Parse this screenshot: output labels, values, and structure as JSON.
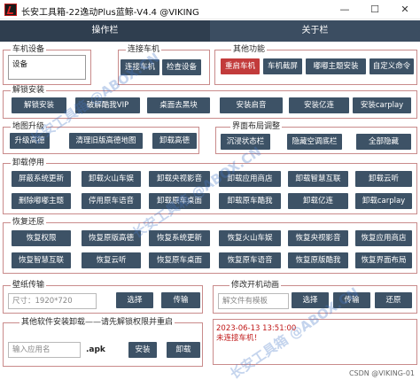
{
  "window": {
    "title": "长安工具箱-22逸动Plus蓝鲸-V4.4 @VIKING",
    "minimize": "—",
    "maximize": "☐",
    "close": "✕"
  },
  "tabs": [
    {
      "label": "操作栏",
      "active": true
    },
    {
      "label": "关于栏",
      "active": false
    }
  ],
  "device_section": {
    "label": "车机设备",
    "device_value": "设备"
  },
  "connect_section": {
    "label": "连接车机",
    "buttons": [
      "连接车机",
      "检查设备"
    ]
  },
  "other_section": {
    "label": "其他功能",
    "buttons": [
      "重启车机",
      "车机截屏",
      "嘟嘟主题安装",
      "自定义命令"
    ]
  },
  "crack_section": {
    "label": "解锁安装",
    "buttons": [
      "解锁安装",
      "破解酷我VIP",
      "桌面去黑块",
      "安装启音",
      "安装亿连",
      "安装carplay"
    ]
  },
  "map_section": {
    "label": "地图升级",
    "buttons": [
      "升级高德",
      "清理旧版高德地图",
      "卸载高德"
    ]
  },
  "layout_section": {
    "label": "界面布局调整",
    "buttons": [
      "沉浸状态栏",
      "隐藏空调底栏",
      "全部隐藏"
    ]
  },
  "uninstall_section": {
    "label": "卸载停用",
    "rows": [
      [
        "屏蔽系统更新",
        "卸载火山车娱",
        "卸载央视影音",
        "卸载应用商店",
        "卸载智慧互联",
        "卸载云听"
      ],
      [
        "删除嘟嘟主题",
        "停用原车语音",
        "卸载原车桌面",
        "卸载原车酷我",
        "卸载亿连",
        "卸载carplay"
      ]
    ]
  },
  "restore_section": {
    "label": "恢复还原",
    "rows": [
      [
        "恢复权限",
        "恢复原版高德",
        "恢复系统更新",
        "恢复火山车娱",
        "恢复央视影音",
        "恢复应用商店"
      ],
      [
        "恢复智慧互联",
        "恢复云听",
        "恢复原车桌面",
        "恢复原车语音",
        "恢复原版酷我",
        "恢复界面布局"
      ]
    ]
  },
  "wallpaper_section": {
    "label": "壁纸传输",
    "placeholder": "尺寸：1920*720",
    "buttons": [
      "选择",
      "传输"
    ]
  },
  "boot_section": {
    "label": "修改开机动画",
    "placeholder": "解文件有模板",
    "buttons": [
      "选择",
      "传输",
      "还原"
    ]
  },
  "apk_section": {
    "label": "其他软件安装卸载——请先解锁权限并重启",
    "placeholder": "输入应用名",
    "suffix": ".apk",
    "buttons": [
      "安装",
      "卸载"
    ]
  },
  "status_log": {
    "date": "2023-06-13 13:51:00",
    "message": "未连接车机！"
  },
  "watermark": "长安工具箱 @ABOX.CN",
  "footer_credit": "CSDN @VIKING-01"
}
